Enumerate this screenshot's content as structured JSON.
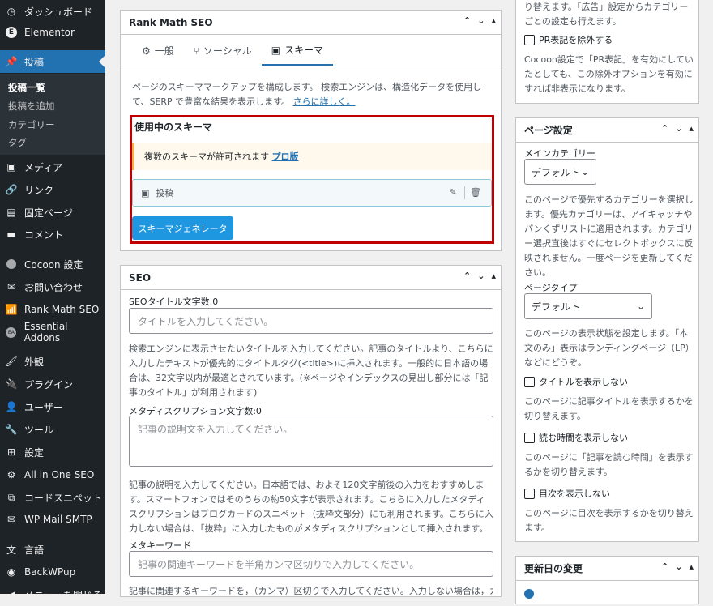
{
  "sidebar": {
    "items": [
      {
        "label": "ダッシュボード",
        "icon": "dashboard-icon"
      },
      {
        "label": "Elementor",
        "icon": "elementor-icon"
      },
      {
        "label": "投稿",
        "icon": "pin-icon"
      },
      {
        "label": "メディア",
        "icon": "media-icon"
      },
      {
        "label": "リンク",
        "icon": "link-icon"
      },
      {
        "label": "固定ページ",
        "icon": "page-icon"
      },
      {
        "label": "コメント",
        "icon": "comment-icon"
      },
      {
        "label": "Cocoon 設定",
        "icon": "cocoon-icon"
      },
      {
        "label": "お問い合わせ",
        "icon": "mail-icon"
      },
      {
        "label": "Rank Math SEO",
        "icon": "rankmath-icon"
      },
      {
        "label": "Essential Addons",
        "icon": "ea-icon"
      },
      {
        "label": "外観",
        "icon": "brush-icon"
      },
      {
        "label": "プラグイン",
        "icon": "plugin-icon"
      },
      {
        "label": "ユーザー",
        "icon": "user-icon"
      },
      {
        "label": "ツール",
        "icon": "wrench-icon"
      },
      {
        "label": "設定",
        "icon": "settings-icon"
      },
      {
        "label": "All in One SEO",
        "icon": "aioseo-icon"
      },
      {
        "label": "コードスニペット",
        "icon": "snippet-icon"
      },
      {
        "label": "WP Mail SMTP",
        "icon": "smtp-icon"
      },
      {
        "label": "言語",
        "icon": "language-icon"
      },
      {
        "label": "BackWPup",
        "icon": "backwpup-icon"
      },
      {
        "label": "メニューを閉じる",
        "icon": "collapse-icon"
      }
    ],
    "submenu": [
      "投稿一覧",
      "投稿を追加",
      "カテゴリー",
      "タグ"
    ]
  },
  "rankmath": {
    "title": "Rank Math SEO",
    "tabs": [
      {
        "label": "一般"
      },
      {
        "label": "ソーシャル"
      },
      {
        "label": "スキーマ"
      }
    ],
    "desc": "ページのスキーママークアップを構成します。 検索エンジンは、構造化データを使用して、SERP で豊富な結果を表示します。",
    "more_link": "さらに詳しく。",
    "in_use_heading": "使用中のスキーマ",
    "notice": "複数のスキーマが許可されます",
    "pro_link": "プロ版",
    "schema_item": "投稿",
    "generator_button": "スキーマジェネレータ"
  },
  "seo": {
    "title": "SEO",
    "title_label": "SEOタイトル文字数:0",
    "title_placeholder": "タイトルを入力してください。",
    "title_help": "検索エンジンに表示させたいタイトルを入力してください。記事のタイトルより、こちらに入力したテキストが優先的にタイトルタグ(<title>)に挿入されます。一般的に日本語の場合は、32文字以内が最適とされています。(※ページやインデックスの見出し部分には「記事のタイトル」が利用されます)",
    "desc_label": "メタディスクリプション文字数:0",
    "desc_placeholder": "記事の説明文を入力してください。",
    "desc_help": "記事の説明を入力してください。日本語では、およそ120文字前後の入力をおすすめします。スマートフォンではそのうちの約50文字が表示されます。こちらに入力したメタディスクリプションはブログカードのスニペット（抜粋文部分）にも利用されます。こちらに入力しない場合は、「抜粋」に入力したものがメタディスクリプションとして挿入されます。",
    "kw_label": "メタキーワード",
    "kw_placeholder": "記事の関連キーワードを半角カンマ区切りで入力してください。",
    "kw_help": "記事に関連するキーワードを，（カンマ）区切りで入力してください。入力しない場合は，カテ"
  },
  "top_right": {
    "text1": "り替えます。「広告」設定からカテゴリーごとの設定も行えます。",
    "pr_checkbox": "PR表記を除外する",
    "text2": "Cocoon設定で「PR表記」を有効にしていたとしても、この除外オプションを有効にすれば非表示になります。"
  },
  "page_settings": {
    "title": "ページ設定",
    "main_cat_label": "メインカテゴリー",
    "main_cat_value": "デフォルト",
    "main_cat_help": "このページで優先するカテゴリーを選択します。優先カテゴリーは、アイキャッチやパンくずリストに適用されます。カテゴリー選択直後はすぐにセレクトボックスに反映されません。一度ページを更新してください。",
    "page_type_label": "ページタイプ",
    "page_type_value": "デフォルト",
    "page_type_help": "このページの表示状態を設定します。「本文のみ」表示はランディングページ（LP）などにどうぞ。",
    "hide_title": "タイトルを表示しない",
    "hide_title_help": "このページに記事タイトルを表示するかを切り替えます。",
    "hide_readtime": "読む時間を表示しない",
    "hide_readtime_help": "このページに「記事を読む時間」を表示するかを切り替えます。",
    "hide_toc": "目次を表示しない",
    "hide_toc_help": "このページに目次を表示するかを切り替えます。"
  },
  "update_change": {
    "title": "更新日の変更"
  },
  "colors": {
    "accent": "#2271b1",
    "highlight_border": "#c00000",
    "button": "#1e96e0",
    "notice_bg": "#fff8ed",
    "notice_border": "#f0b849"
  }
}
